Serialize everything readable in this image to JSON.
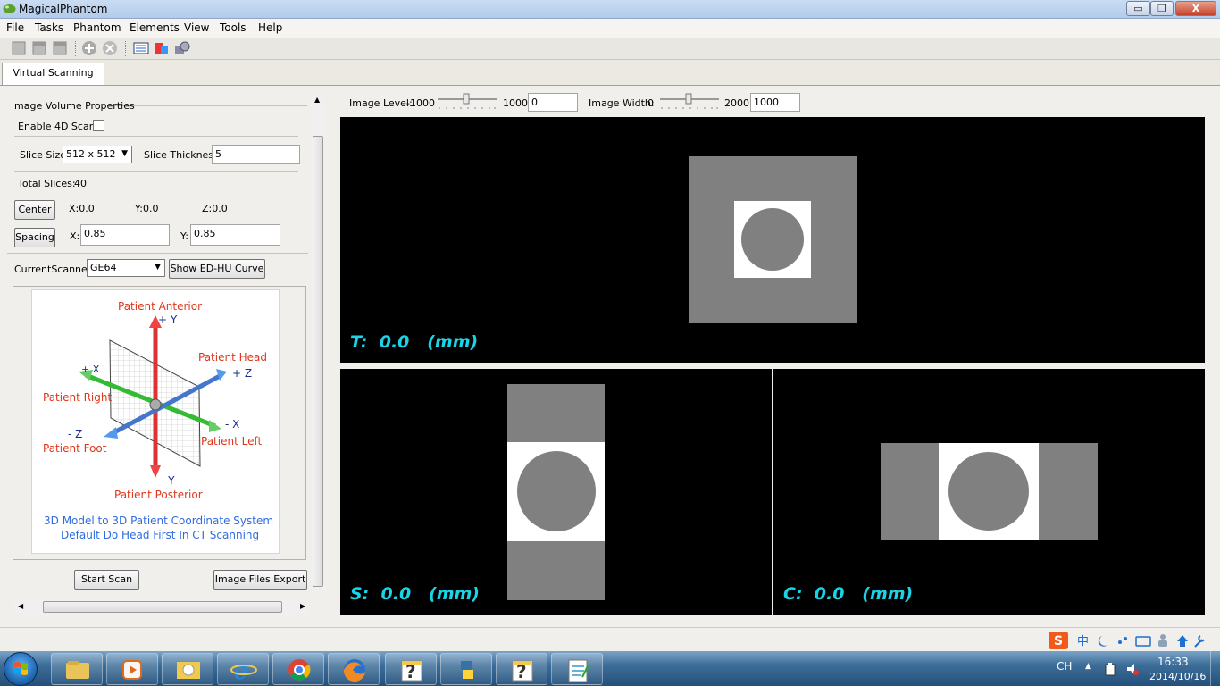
{
  "window": {
    "title": "MagicalPhantom",
    "controls": {
      "minimize": "▭",
      "maximize": "❐",
      "close": "X"
    }
  },
  "menu": [
    "File",
    "Tasks",
    "Phantom",
    "Elements",
    "View",
    "Tools",
    "Help"
  ],
  "toolbar": {
    "icons": [
      "new-icon",
      "open-icon",
      "save-icon",
      "add-icon",
      "remove-icon",
      "scanner-icon",
      "export-icon",
      "settings-icon"
    ]
  },
  "tab": {
    "label": "Virtual Scanning View"
  },
  "properties": {
    "group_title": "mage Volume Properties",
    "enable_4d_label": "Enable 4D Scan:",
    "enable_4d_checked": false,
    "slice_size_label": "Slice Size:",
    "slice_size_value": "512 x 512",
    "slice_thickness_label": "Slice Thickness:",
    "slice_thickness_value": "5",
    "total_slices_label": "Total Slices:",
    "total_slices_value": "40",
    "center_button": "Center",
    "center_x": "X:0.0",
    "center_y": "Y:0.0",
    "center_z": "Z:0.0",
    "spacing_button": "Spacing",
    "spacing_x_label": "X:",
    "spacing_x_value": "0.85",
    "spacing_y_label": "Y:",
    "spacing_y_value": "0.85",
    "scanner_label": "CurrentScanner:",
    "scanner_value": "GE64",
    "ed_hu_button": "Show ED-HU Curve"
  },
  "diagram": {
    "anterior": "Patient Anterior",
    "plus_y": "+ Y",
    "head": "Patient Head",
    "plus_z": "+ Z",
    "plus_x": "+ X",
    "right": "Patient Right",
    "minus_x": "- X",
    "minus_z": "- Z",
    "left": "Patient Left",
    "foot": "Patient Foot",
    "minus_y": "- Y",
    "posterior": "Patient Posterior",
    "caption_line1": "3D Model  to 3D Patient Coordinate   System",
    "caption_line2": "Default Do Head First In  CT Scanning"
  },
  "actions": {
    "start_scan": "Start Scan",
    "export": "Image Files Export"
  },
  "image_controls": {
    "level_label": "Image Level:",
    "level_min": "-1000",
    "level_max": "1000",
    "level_value": "0",
    "width_label": "Image Width:",
    "width_min": "0",
    "width_max": "2000",
    "width_value": "1000"
  },
  "viewports": {
    "transverse": "T:  0.0   (mm)",
    "sagittal": "S:  0.0   (mm)",
    "coronal": "C:  0.0   (mm)"
  },
  "colors": {
    "viewport_bg": "#000000",
    "label_cyan": "#19d3e6",
    "phantom_gray": "#808080",
    "phantom_white": "#ffffff"
  },
  "taskbar": {
    "apps": [
      "explorer-icon",
      "media-player-icon",
      "outlook-icon",
      "internet-explorer-icon",
      "chrome-icon",
      "firefox-icon",
      "help-icon",
      "python-icon",
      "help-icon-2",
      "notepad-icon"
    ],
    "lang": "CH",
    "time": "16:33",
    "date": "2014/10/16"
  }
}
